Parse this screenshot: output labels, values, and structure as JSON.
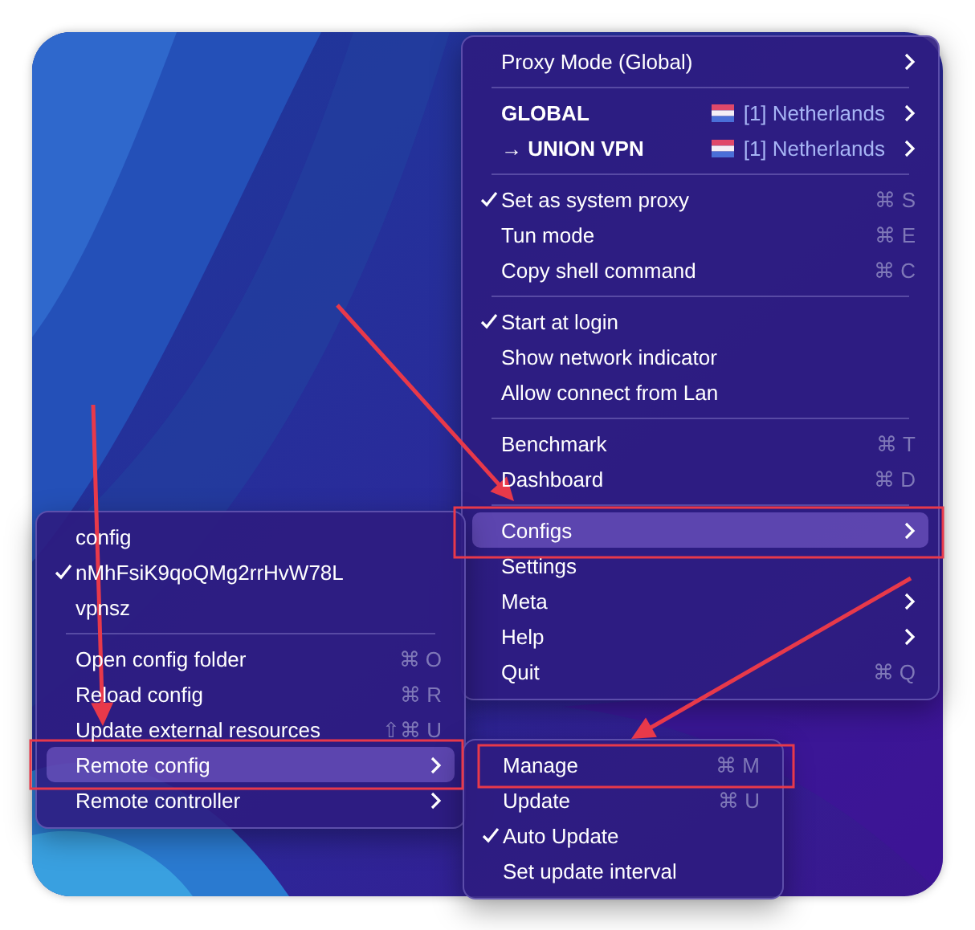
{
  "menus": [
    {
      "kind": "main",
      "items": [
        {
          "kind": "item",
          "label": "Proxy Mode (Global)",
          "checked": false,
          "has_submenu": true,
          "highlighted": false,
          "bold": false
        },
        {
          "kind": "separator"
        },
        {
          "kind": "item",
          "label": "GLOBAL",
          "detail": "[1] Netherlands",
          "checked": false,
          "has_submenu": true,
          "highlighted": false,
          "bold": true
        },
        {
          "kind": "item",
          "label": "→ UNION VPN",
          "detail": "[1] Netherlands",
          "checked": false,
          "has_submenu": true,
          "highlighted": false,
          "bold": true
        },
        {
          "kind": "separator"
        },
        {
          "kind": "item",
          "label": "Set as system proxy",
          "shortcut": "⌘ S",
          "checked": true,
          "has_submenu": false,
          "highlighted": false,
          "bold": false
        },
        {
          "kind": "item",
          "label": "Tun mode",
          "shortcut": "⌘ E",
          "checked": false,
          "has_submenu": false,
          "highlighted": false,
          "bold": false
        },
        {
          "kind": "item",
          "label": "Copy shell command",
          "shortcut": "⌘ C",
          "checked": false,
          "has_submenu": false,
          "highlighted": false,
          "bold": false
        },
        {
          "kind": "separator"
        },
        {
          "kind": "item",
          "label": "Start at login",
          "checked": true,
          "has_submenu": false,
          "highlighted": false,
          "bold": false
        },
        {
          "kind": "item",
          "label": "Show network indicator",
          "checked": false,
          "has_submenu": false,
          "highlighted": false,
          "bold": false
        },
        {
          "kind": "item",
          "label": "Allow connect from Lan",
          "checked": false,
          "has_submenu": false,
          "highlighted": false,
          "bold": false
        },
        {
          "kind": "separator"
        },
        {
          "kind": "item",
          "label": "Benchmark",
          "shortcut": "⌘ T",
          "checked": false,
          "has_submenu": false,
          "highlighted": false,
          "bold": false
        },
        {
          "kind": "item",
          "label": "Dashboard",
          "shortcut": "⌘ D",
          "checked": false,
          "has_submenu": false,
          "highlighted": false,
          "bold": false
        },
        {
          "kind": "separator"
        },
        {
          "kind": "item",
          "label": "Configs",
          "checked": false,
          "has_submenu": true,
          "highlighted": true,
          "bold": false
        },
        {
          "kind": "item",
          "label": "Settings",
          "checked": false,
          "has_submenu": false,
          "highlighted": false,
          "bold": false
        },
        {
          "kind": "item",
          "label": "Meta",
          "checked": false,
          "has_submenu": true,
          "highlighted": false,
          "bold": false
        },
        {
          "kind": "item",
          "label": "Help",
          "checked": false,
          "has_submenu": true,
          "highlighted": false,
          "bold": false
        },
        {
          "kind": "item",
          "label": "Quit",
          "shortcut": "⌘ Q",
          "checked": false,
          "has_submenu": false,
          "highlighted": false,
          "bold": false
        }
      ]
    },
    {
      "kind": "configs",
      "items": [
        {
          "kind": "item",
          "label": "config",
          "checked": false,
          "has_submenu": false,
          "highlighted": false,
          "bold": false
        },
        {
          "kind": "item",
          "label": "nMhFsiK9qoQMg2rrHvW78L",
          "checked": true,
          "has_submenu": false,
          "highlighted": false,
          "bold": false
        },
        {
          "kind": "item",
          "label": "vpnsz",
          "checked": false,
          "has_submenu": false,
          "highlighted": false,
          "bold": false
        },
        {
          "kind": "separator"
        },
        {
          "kind": "item",
          "label": "Open config folder",
          "shortcut": "⌘ O",
          "checked": false,
          "has_submenu": false,
          "highlighted": false,
          "bold": false
        },
        {
          "kind": "item",
          "label": "Reload config",
          "shortcut": "⌘ R",
          "checked": false,
          "has_submenu": false,
          "highlighted": false,
          "bold": false
        },
        {
          "kind": "item",
          "label": "Update external resources",
          "shortcut": "⇧⌘ U",
          "checked": false,
          "has_submenu": false,
          "highlighted": false,
          "bold": false
        },
        {
          "kind": "item",
          "label": "Remote config",
          "checked": false,
          "has_submenu": true,
          "highlighted": true,
          "bold": false
        },
        {
          "kind": "item",
          "label": "Remote controller",
          "checked": false,
          "has_submenu": true,
          "highlighted": false,
          "bold": false
        }
      ]
    },
    {
      "kind": "remote",
      "items": [
        {
          "kind": "item",
          "label": "Manage",
          "shortcut": "⌘ M",
          "checked": false,
          "has_submenu": false,
          "highlighted": false,
          "bold": false
        },
        {
          "kind": "item",
          "label": "Update",
          "shortcut": "⌘ U",
          "checked": false,
          "has_submenu": false,
          "highlighted": false,
          "bold": false
        },
        {
          "kind": "item",
          "label": "Auto Update",
          "checked": true,
          "has_submenu": false,
          "highlighted": false,
          "bold": false
        },
        {
          "kind": "item",
          "label": "Set update interval",
          "checked": false,
          "has_submenu": false,
          "highlighted": false,
          "bold": false
        }
      ]
    }
  ]
}
